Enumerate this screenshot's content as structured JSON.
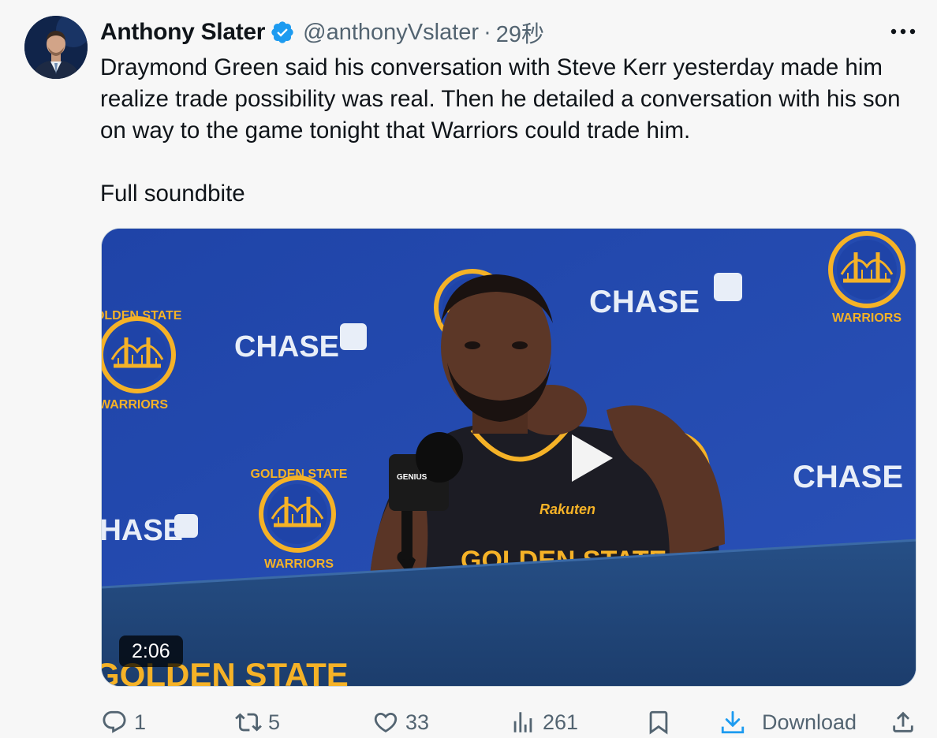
{
  "author": {
    "display_name": "Anthony Slater",
    "handle": "@anthonyVslater",
    "time": "29秒",
    "verified": true,
    "badge_color": "#1d9bf0"
  },
  "tweet": {
    "text": "Draymond Green said his conversation with Steve Kerr yesterday made him realize trade possibility was real. Then he detailed a conversation with his son on way to the game tonight that Warriors could trade him.",
    "text2": "Full soundbite"
  },
  "video": {
    "duration": "2:06",
    "backdrop_sponsor": "CHASE",
    "team_logo_text_top": "GOLDEN STATE",
    "team_logo_text_bottom": "WARRIORS",
    "jersey_sponsor": "Rakuten",
    "mic_label": "GENIUS"
  },
  "actions": {
    "reply_count": "1",
    "retweet_count": "5",
    "like_count": "33",
    "views_count": "261",
    "download_label": "Download"
  },
  "colors": {
    "text_primary": "#0f1419",
    "text_secondary": "#536471",
    "accent": "#1d9bf0",
    "backdrop_blue": "#2347a8",
    "warriors_gold": "#f5b227"
  },
  "icons": {
    "more": "more-icon",
    "verified": "verified-badge-icon",
    "play": "play-icon",
    "reply": "reply-icon",
    "retweet": "retweet-icon",
    "like": "heart-icon",
    "views": "views-chart-icon",
    "bookmark": "bookmark-icon",
    "download": "download-icon",
    "share": "share-icon"
  }
}
